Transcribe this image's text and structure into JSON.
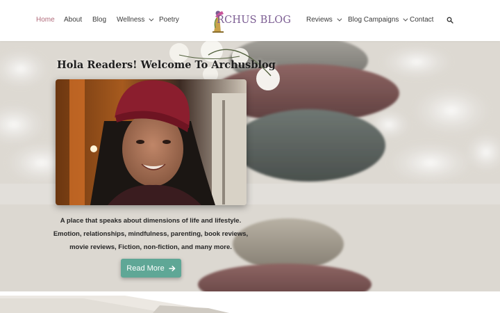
{
  "site": {
    "logo_text": "RCHUS BLOG"
  },
  "nav": {
    "left": [
      {
        "label": "Home",
        "active": true
      },
      {
        "label": "About"
      },
      {
        "label": "Blog"
      },
      {
        "label": "Wellness",
        "dropdown": true
      },
      {
        "label": "Poetry"
      }
    ],
    "right": [
      {
        "label": "Reviews",
        "dropdown": true
      },
      {
        "label": "Blog Campaigns",
        "dropdown": true
      },
      {
        "label": "Contact"
      }
    ],
    "search_icon": "search-icon"
  },
  "hero": {
    "title": "Hola Readers! Welcome To Archusblog",
    "description_lines": [
      "A place that speaks about dimensions of life and lifestyle.",
      "Emotion, relationships, mindfulness, parenting, book reviews,",
      "movie reviews, Fiction, non-fiction, and many more."
    ],
    "button_label": "Read More",
    "button_icon": "arrow-right-icon"
  },
  "colors": {
    "accent": "#5fa796",
    "nav_active": "#b06a7a",
    "logo": "#7b5c92"
  }
}
